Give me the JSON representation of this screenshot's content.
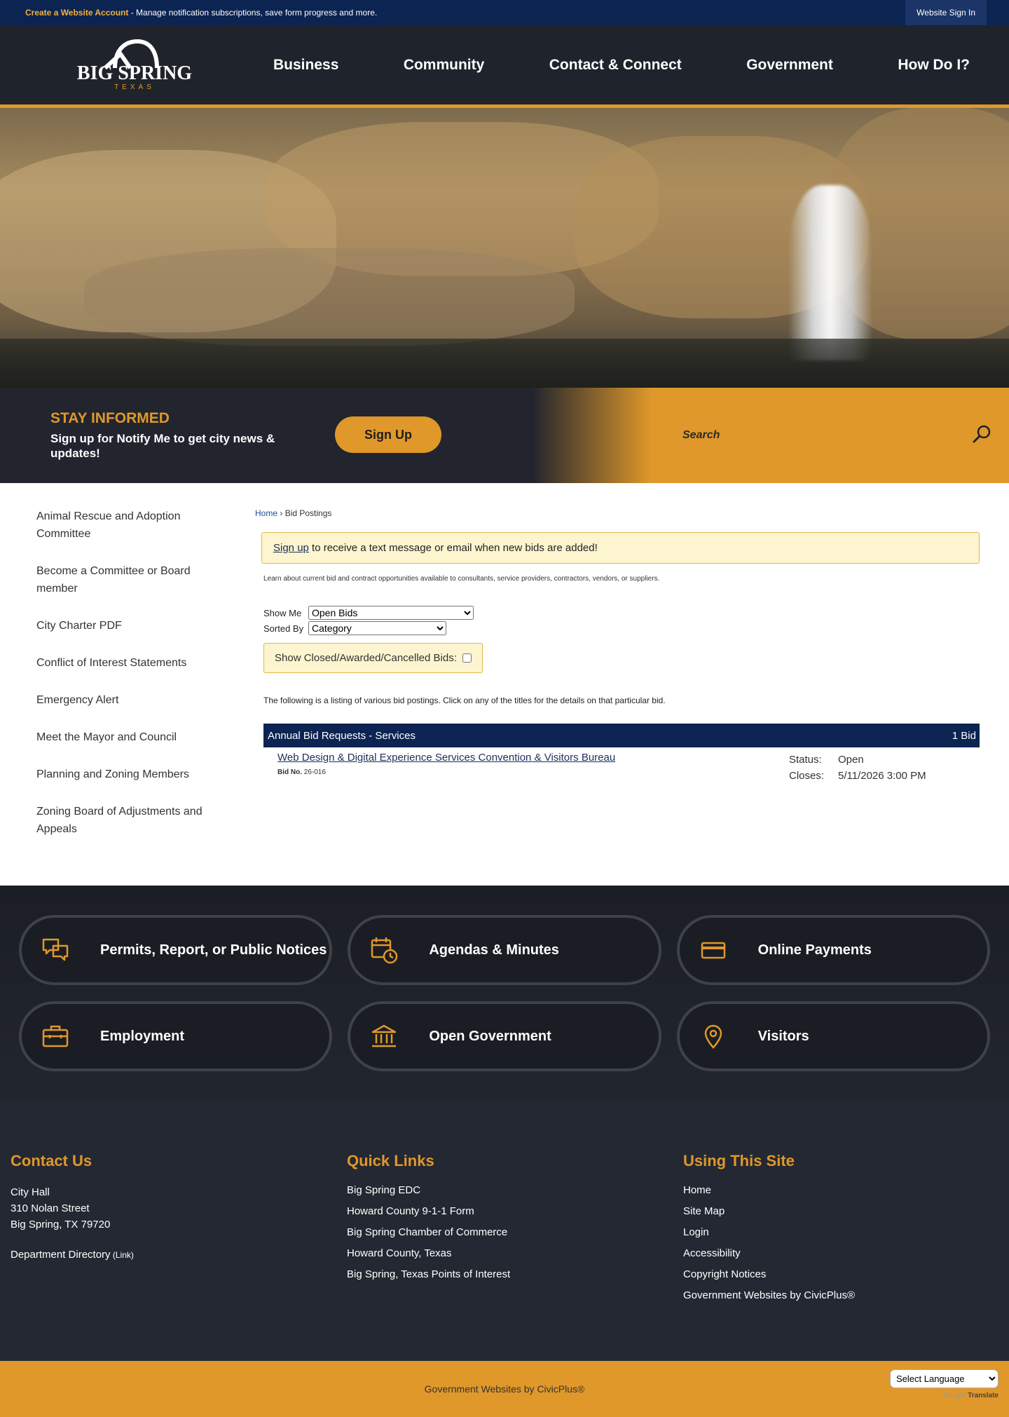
{
  "topbar": {
    "create_account": "Create a Website Account",
    "create_account_desc": " - Manage notification subscriptions, save form progress and more.",
    "sign_in": "Website Sign In"
  },
  "logo": {
    "name": "BIG SPRING",
    "sub": "TEXAS"
  },
  "nav": [
    "Business",
    "Community",
    "Contact & Connect",
    "Government",
    "How Do I?"
  ],
  "stay": {
    "title": "STAY INFORMED",
    "text_pre": "Sign up for ",
    "text_bold": "Notify Me",
    "text_post": " to get city news & updates!",
    "button": "Sign Up",
    "search_placeholder": "Search"
  },
  "sidebar": [
    "Animal Rescue and Adoption Committee",
    "Become a Committee or Board member",
    "City Charter PDF",
    "Conflict of Interest Statements",
    "Emergency Alert",
    "Meet the Mayor and Council",
    "Planning and Zoning Members",
    "Zoning Board of Adjustments and Appeals"
  ],
  "breadcrumb": {
    "home": "Home",
    "sep": " › ",
    "current": "Bid Postings"
  },
  "alert": {
    "link": "Sign up",
    "text": " to receive a text message or email when new bids are added!"
  },
  "intro": "Learn about current bid and contract opportunities available to consultants, service providers, contractors, vendors, or suppliers.",
  "filters": {
    "show_label": "Show Me",
    "show_value": "Open Bids",
    "sort_label": "Sorted By",
    "sort_value": "Category",
    "closed_label": "Show Closed/Awarded/Cancelled Bids:"
  },
  "listing_text": "The following is a listing of various bid postings. Click on any of the titles for the details on that particular bid.",
  "category": {
    "name": "Annual Bid Requests - Services",
    "count": "1 Bid"
  },
  "bid": {
    "title": "Web Design & Digital Experience Services Convention & Visitors Bureau",
    "no_label": "Bid No.",
    "no_value": " 26-016",
    "status_label": "Status:",
    "status_value": "Open",
    "closes_label": "Closes:",
    "closes_value": "5/11/2026 3:00 PM"
  },
  "quick": [
    {
      "label": "Permits, Report, or Public Notices",
      "icon": "chat-bubbles-icon"
    },
    {
      "label": "Agendas & Minutes",
      "icon": "calendar-clock-icon"
    },
    {
      "label": "Online Payments",
      "icon": "credit-card-icon"
    },
    {
      "label": "Employment",
      "icon": "briefcase-icon"
    },
    {
      "label": "Open Government",
      "icon": "government-building-icon"
    },
    {
      "label": "Visitors",
      "icon": "map-pin-icon"
    }
  ],
  "footer": {
    "contact": {
      "title": "Contact Us",
      "line1": "City Hall",
      "line2": "310 Nolan Street",
      "line3": "Big Spring, TX 79720",
      "dept": "Department Directory",
      "dept_link": " (Link)"
    },
    "quick_links": {
      "title": "Quick Links",
      "items": [
        "Big Spring EDC",
        "Howard County 9-1-1 Form",
        "Big Spring Chamber of Commerce",
        "Howard County, Texas",
        "Big Spring, Texas Points of Interest"
      ]
    },
    "using_site": {
      "title": "Using This Site",
      "items": [
        "Home",
        "Site Map",
        "Login",
        "Accessibility",
        "Copyright Notices",
        "Government Websites by CivicPlus®"
      ]
    }
  },
  "bottom": {
    "credit": "Government Websites by CivicPlus®",
    "language": "Select Language",
    "powered": "Google",
    "translate": "Translate"
  },
  "colors": {
    "navy": "#0c2452",
    "gold": "#e0982a",
    "dark": "#1f232b"
  }
}
